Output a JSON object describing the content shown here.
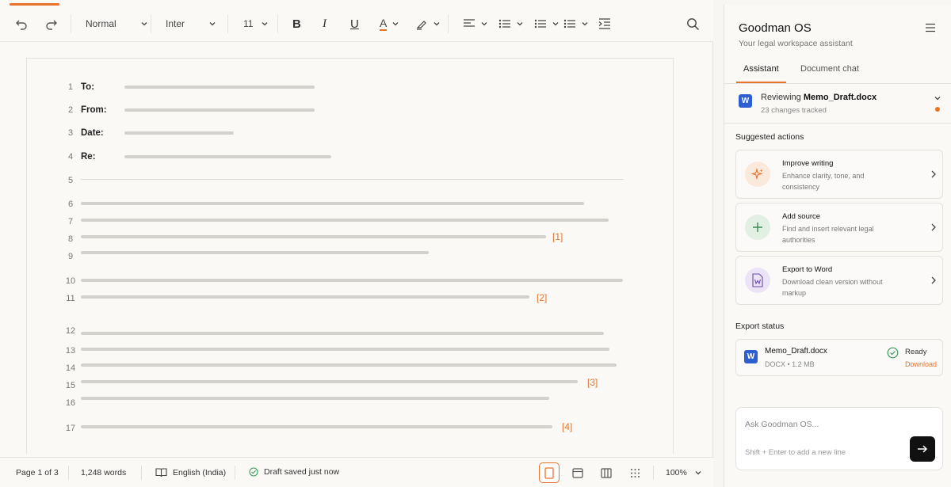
{
  "toolbar": {
    "style_select": "Normal",
    "font_select": "Inter",
    "size_select": "11",
    "bold": "B",
    "italic": "I",
    "underline": "U",
    "text_color_letter": "A"
  },
  "document": {
    "line_numbers": [
      "1",
      "2",
      "3",
      "4",
      "5",
      "6",
      "7",
      "8",
      "9",
      "10",
      "11",
      "12",
      "13",
      "14",
      "15",
      "16",
      "17"
    ],
    "fields": {
      "to": "To:",
      "from": "From:",
      "date": "Date:",
      "re": "Re:"
    },
    "citations": [
      "[1]",
      "[2]",
      "[3]",
      "[4]"
    ]
  },
  "statusbar": {
    "page": "Page 1 of 3",
    "words": "1,248 words",
    "language": "English (India)",
    "save_status": "Draft saved just now",
    "zoom": "100%"
  },
  "assistant": {
    "title": "Goodman OS",
    "subtitle": "Your legal workspace assistant",
    "tabs": [
      "Assistant",
      "Document chat"
    ],
    "review": {
      "prefix": "Reviewing ",
      "file": "Memo_Draft.docx",
      "changes": "23 changes tracked",
      "icon_letter": "W"
    },
    "suggested_title": "Suggested actions",
    "actions": [
      {
        "title": "Improve writing",
        "desc": "Enhance clarity, tone, and consistency",
        "icon": "sparkle-icon"
      },
      {
        "title": "Add source",
        "desc": "Find and insert relevant legal authorities",
        "icon": "plus-icon"
      },
      {
        "title": "Export to Word",
        "desc": "Download clean version without markup",
        "icon": "word-doc-icon"
      }
    ],
    "export_title": "Export status",
    "export": {
      "file": "Memo_Draft.docx",
      "meta": "DOCX • 1.2 MB",
      "status": "Ready",
      "action": "Download",
      "icon_letter": "W"
    },
    "chat": {
      "placeholder": "Ask Goodman OS...",
      "hint": "Shift + Enter to add a new line"
    }
  },
  "colors": {
    "accent": "#e8722a",
    "word_blue": "#2d5fd0"
  }
}
